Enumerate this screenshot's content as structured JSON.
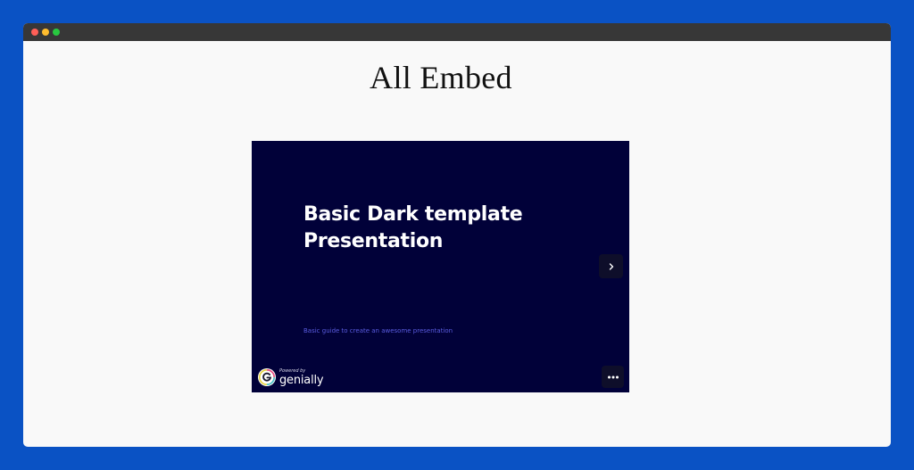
{
  "page": {
    "title": "All Embed"
  },
  "embed": {
    "slide_title_line1": "Basic Dark template",
    "slide_title_line2": "Presentation",
    "slide_subtitle": "Basic guide to create an awesome presentation",
    "brand_powered": "Powered by",
    "brand_name": "genially",
    "next_icon": "chevron-right-icon",
    "more_icon": "more-horizontal-icon",
    "logo_icon": "genially-logo-icon"
  },
  "colors": {
    "outer_background": "#0a52c4",
    "window_background": "#f9f9f9",
    "titlebar": "#373737",
    "slide_background": "#010139",
    "subtitle_accent": "#5a5ce0"
  }
}
